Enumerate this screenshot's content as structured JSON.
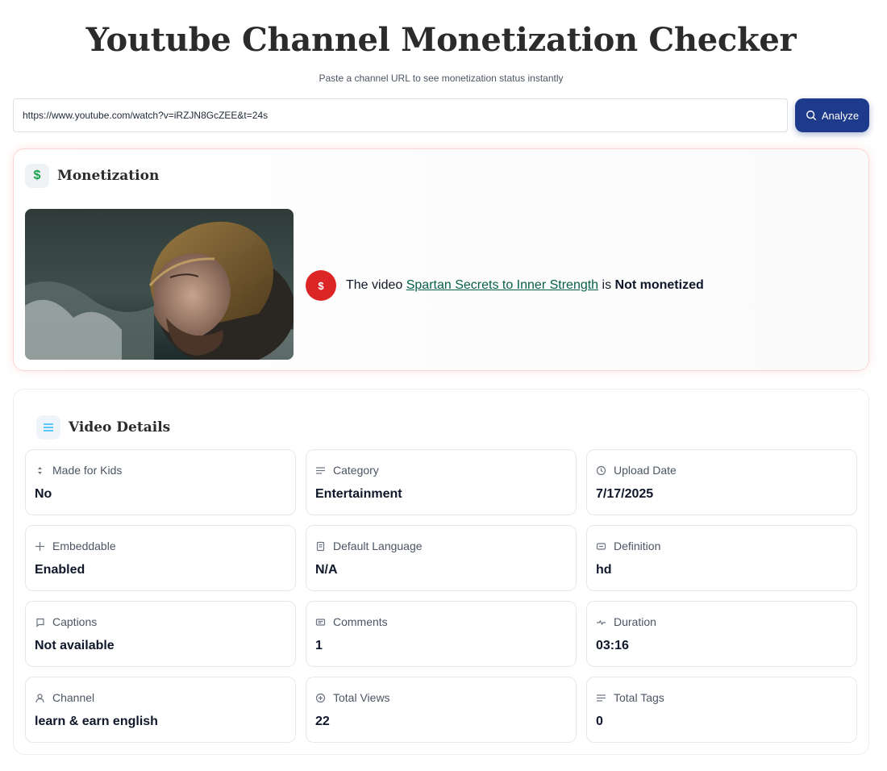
{
  "header": {
    "title": "Youtube Channel Monetization Checker",
    "subtitle": "Paste a channel URL to see monetization status instantly"
  },
  "search": {
    "value": "https://www.youtube.com/watch?v=iRZJN8GcZEE&t=24s",
    "button_label": "Analyze",
    "button_icon": "search-icon"
  },
  "monetization": {
    "title": "Monetization",
    "icon": "dollar-icon",
    "status_icon": "dollar-icon",
    "prefix": "The video",
    "video_title": "Spartan Secrets to Inner Strength",
    "is": " is ",
    "status": "Not monetized",
    "status_color": "#dc2626"
  },
  "details": {
    "title": "Video Details",
    "icon": "list-icon",
    "items": [
      {
        "label": "Made for Kids",
        "value": "No",
        "icon": "sort-icon"
      },
      {
        "label": "Category",
        "value": "Entertainment",
        "icon": "list-icon"
      },
      {
        "label": "Upload Date",
        "value": "7/17/2025",
        "icon": "clock-icon"
      },
      {
        "label": "Embeddable",
        "value": "Enabled",
        "icon": "plus-icon"
      },
      {
        "label": "Default Language",
        "value": "N/A",
        "icon": "book-icon"
      },
      {
        "label": "Definition",
        "value": "hd",
        "icon": "screen-icon"
      },
      {
        "label": "Captions",
        "value": "Not available",
        "icon": "caption-icon"
      },
      {
        "label": "Comments",
        "value": "1",
        "icon": "comment-icon"
      },
      {
        "label": "Duration",
        "value": "03:16",
        "icon": "activity-icon"
      },
      {
        "label": "Channel",
        "value": "learn & earn english",
        "icon": "user-icon"
      },
      {
        "label": "Total Views",
        "value": "22",
        "icon": "plus-circle-icon"
      },
      {
        "label": "Total Tags",
        "value": "0",
        "icon": "list-icon"
      }
    ]
  },
  "colors": {
    "accent": "#1e3a8a",
    "money": "#16a34a",
    "link": "#065f46"
  }
}
